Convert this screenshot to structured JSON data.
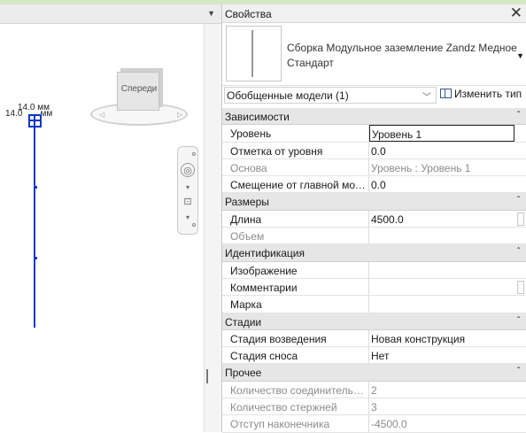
{
  "viewport": {
    "dim_top": "14.0 мм",
    "dim_left": "14.0",
    "dim_left_tail": "мм",
    "viewcube_label": "Спереди",
    "colors": {
      "element": "#0b36c9"
    }
  },
  "properties": {
    "title": "Свойства",
    "type_name": "Сборка Модульное заземление Zandz Медное Стандарт",
    "category_selector": "Обобщенные модели (1)",
    "edit_type_label": "Изменить тип",
    "groups": [
      {
        "label": "Зависимости",
        "rows": [
          {
            "name": "Уровень",
            "value": "Уровень 1",
            "readonly": false,
            "editing": true
          },
          {
            "name": "Отметка от уровня",
            "value": "0.0",
            "readonly": false
          },
          {
            "name": "Основа",
            "value": "Уровень : Уровень 1",
            "readonly": true
          },
          {
            "name": "Смещение от главной модели",
            "value": "0.0",
            "readonly": false
          }
        ]
      },
      {
        "label": "Размеры",
        "rows": [
          {
            "name": "Длина",
            "value": "4500.0",
            "readonly": false,
            "button": true
          },
          {
            "name": "Объем",
            "value": "",
            "readonly": true
          }
        ]
      },
      {
        "label": "Идентификация",
        "rows": [
          {
            "name": "Изображение",
            "value": "",
            "readonly": false
          },
          {
            "name": "Комментарии",
            "value": "",
            "readonly": false,
            "button": true
          },
          {
            "name": "Марка",
            "value": "",
            "readonly": false
          }
        ]
      },
      {
        "label": "Стадии",
        "rows": [
          {
            "name": "Стадия возведения",
            "value": "Новая конструкция",
            "readonly": false
          },
          {
            "name": "Стадия сноса",
            "value": "Нет",
            "readonly": false
          }
        ]
      },
      {
        "label": "Прочее",
        "rows": [
          {
            "name": "Количество соединительных элементов",
            "value": "2",
            "readonly": true
          },
          {
            "name": "Количество стержней",
            "value": "3",
            "readonly": true
          },
          {
            "name": "Отступ наконечника",
            "value": "-4500.0",
            "readonly": true
          }
        ]
      }
    ]
  }
}
